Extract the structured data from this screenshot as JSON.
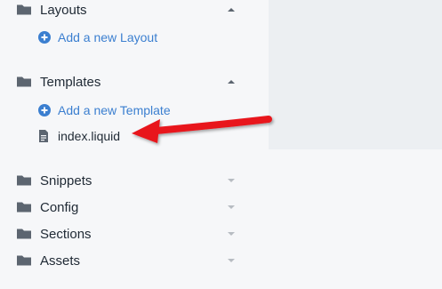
{
  "sidebar": {
    "sections": [
      {
        "label": "Layouts",
        "expanded": true,
        "add_label": "Add a new Layout",
        "icon": "folder-icon"
      },
      {
        "label": "Templates",
        "expanded": true,
        "add_label": "Add a new Template",
        "files": [
          "index.liquid"
        ],
        "icon": "folder-icon"
      },
      {
        "label": "Snippets",
        "expanded": false,
        "icon": "folder-icon"
      },
      {
        "label": "Config",
        "expanded": false,
        "icon": "folder-icon"
      },
      {
        "label": "Sections",
        "expanded": false,
        "icon": "folder-icon"
      },
      {
        "label": "Assets",
        "expanded": false,
        "icon": "folder-icon"
      }
    ]
  },
  "annotation": {
    "arrow_color": "#e8141c",
    "points_to": "index.liquid"
  },
  "colors": {
    "link": "#3b7fd0",
    "text": "#212b36",
    "icon": "#5c6570",
    "caret_active": "#5c6570",
    "caret_inactive": "#b7bcc2"
  }
}
